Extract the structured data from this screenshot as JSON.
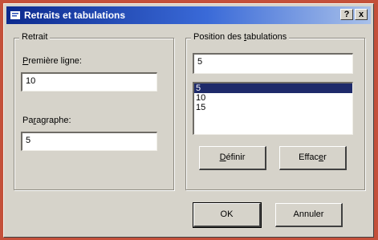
{
  "window": {
    "title": "Retraits et tabulations",
    "help_label": "?",
    "close_label": "x"
  },
  "retrait": {
    "group_title": "Retrait",
    "premiere_ligne": {
      "label_first": "P",
      "label_rest": "remière ligne:",
      "value": "10"
    },
    "paragraphe": {
      "label_first": "Pa",
      "label_underlined": "r",
      "label_rest": "agraphe:",
      "value": "5"
    }
  },
  "tabulations": {
    "group_title_before": "Position des ",
    "group_title_underlined": "t",
    "group_title_after": "abulations",
    "input_value": "5",
    "items": [
      {
        "label": "5",
        "selected": true
      },
      {
        "label": "10",
        "selected": false
      },
      {
        "label": "15",
        "selected": false
      }
    ],
    "define_button": {
      "underlined": "D",
      "rest": "éfinir"
    },
    "clear_button": {
      "before": "Effac",
      "underlined": "e",
      "after": "r"
    }
  },
  "footer": {
    "ok_label": "OK",
    "cancel_label": "Annuler"
  },
  "colors": {
    "titlebar_start": "#0c2a8e",
    "titlebar_end": "#a9c1ea",
    "selection": "#1e2a6a",
    "dialog_bg": "#d6d3ca",
    "frame": "#c4503a"
  }
}
